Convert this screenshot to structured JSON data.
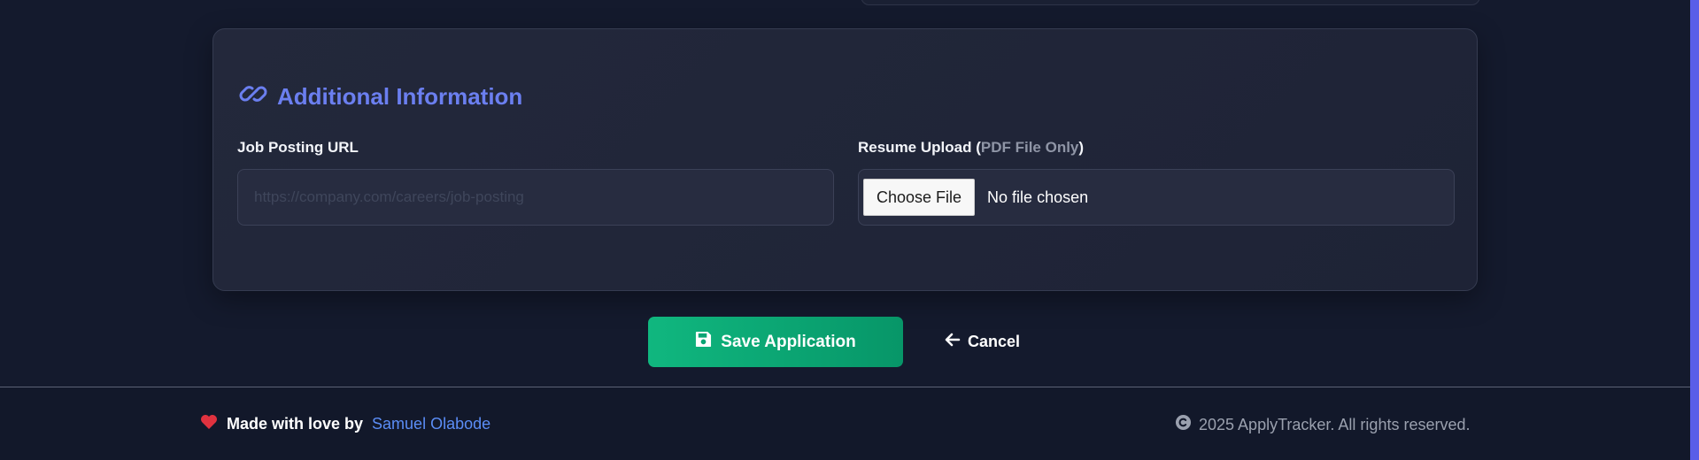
{
  "section": {
    "title": "Additional Information",
    "icon": "link-icon",
    "accent_color": "#6b7ff0"
  },
  "fields": {
    "job_url": {
      "label": "Job Posting URL",
      "placeholder": "https://company.com/careers/job-posting",
      "value": ""
    },
    "resume": {
      "label": "Resume Upload (",
      "hint": "PDF File Only",
      "label_end": ")",
      "button_label": "Choose File",
      "status": "No file chosen"
    }
  },
  "actions": {
    "save_label": "Save Application",
    "save_icon": "floppy-disk-icon",
    "save_color": "#10b77f",
    "cancel_label": "Cancel",
    "cancel_icon": "arrow-left-icon"
  },
  "footer": {
    "made_with": "Made with love by",
    "author": "Samuel Olabode",
    "copyright": "2025 ApplyTracker. All rights reserved.",
    "heart_color": "#e0323f"
  }
}
